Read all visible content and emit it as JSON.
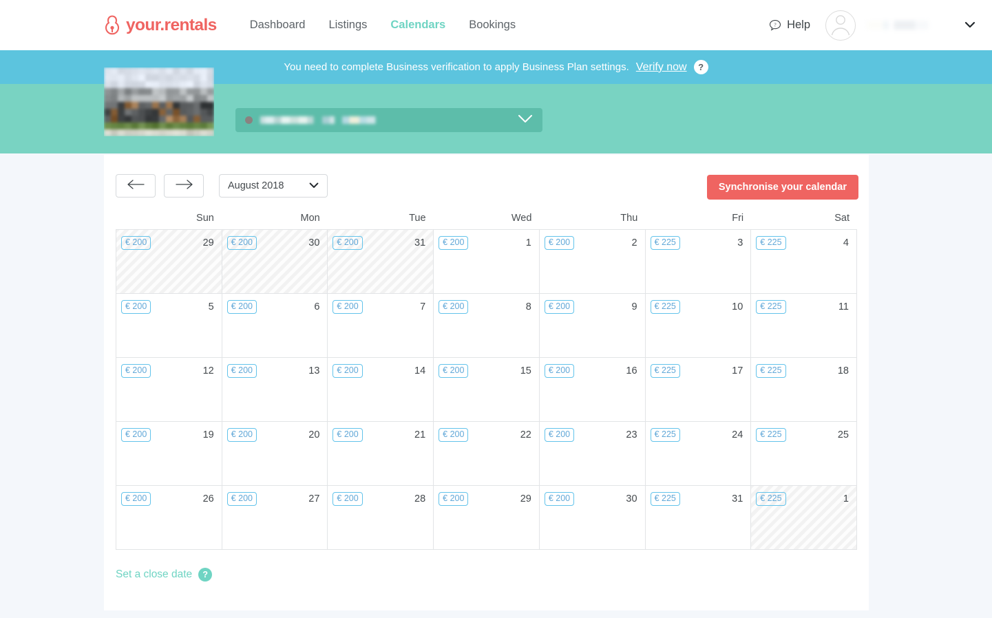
{
  "brand": {
    "name": "your.rentals",
    "logo_icon": "rental-keyhole-icon",
    "color": "#ef6461"
  },
  "nav": {
    "items": [
      {
        "label": "Dashboard",
        "active": false
      },
      {
        "label": "Listings",
        "active": false
      },
      {
        "label": "Calendars",
        "active": true
      },
      {
        "label": "Bookings",
        "active": false
      }
    ],
    "active_color": "#6fd4c3"
  },
  "account": {
    "help_label": "Help",
    "help_icon": "speech-bubble-question-icon",
    "avatar_icon": "user-avatar-icon",
    "user_name": "",
    "caret_icon": "chevron-down-icon"
  },
  "notice": {
    "text": "You need to complete Business verification to apply Business Plan settings.",
    "link_label": "Verify now",
    "help_icon": "question-mark-icon",
    "background": "#5cc4de"
  },
  "property": {
    "thumbnail_alt": "property-photo",
    "selected_name": "",
    "status_dot_color": "#8a8280",
    "chevron_icon": "chevron-down-icon",
    "band_color": "#79d3c2"
  },
  "toolbar": {
    "prev_icon": "arrow-left-icon",
    "next_icon": "arrow-right-icon",
    "month_label": "August 2018",
    "month_chevron_icon": "chevron-down-icon",
    "sync_label": "Synchronise your calendar",
    "sync_color": "#ef6461"
  },
  "calendar": {
    "weekdays": [
      "Sun",
      "Mon",
      "Tue",
      "Wed",
      "Thu",
      "Fri",
      "Sat"
    ],
    "currency": "€",
    "weeks": [
      [
        {
          "day": 29,
          "price": "€ 200",
          "out": true
        },
        {
          "day": 30,
          "price": "€ 200",
          "out": true
        },
        {
          "day": 31,
          "price": "€ 200",
          "out": true
        },
        {
          "day": 1,
          "price": "€ 200",
          "out": false
        },
        {
          "day": 2,
          "price": "€ 200",
          "out": false
        },
        {
          "day": 3,
          "price": "€ 225",
          "out": false
        },
        {
          "day": 4,
          "price": "€ 225",
          "out": false
        }
      ],
      [
        {
          "day": 5,
          "price": "€ 200",
          "out": false
        },
        {
          "day": 6,
          "price": "€ 200",
          "out": false
        },
        {
          "day": 7,
          "price": "€ 200",
          "out": false
        },
        {
          "day": 8,
          "price": "€ 200",
          "out": false
        },
        {
          "day": 9,
          "price": "€ 200",
          "out": false
        },
        {
          "day": 10,
          "price": "€ 225",
          "out": false
        },
        {
          "day": 11,
          "price": "€ 225",
          "out": false
        }
      ],
      [
        {
          "day": 12,
          "price": "€ 200",
          "out": false
        },
        {
          "day": 13,
          "price": "€ 200",
          "out": false
        },
        {
          "day": 14,
          "price": "€ 200",
          "out": false
        },
        {
          "day": 15,
          "price": "€ 200",
          "out": false
        },
        {
          "day": 16,
          "price": "€ 200",
          "out": false
        },
        {
          "day": 17,
          "price": "€ 225",
          "out": false
        },
        {
          "day": 18,
          "price": "€ 225",
          "out": false
        }
      ],
      [
        {
          "day": 19,
          "price": "€ 200",
          "out": false
        },
        {
          "day": 20,
          "price": "€ 200",
          "out": false
        },
        {
          "day": 21,
          "price": "€ 200",
          "out": false
        },
        {
          "day": 22,
          "price": "€ 200",
          "out": false
        },
        {
          "day": 23,
          "price": "€ 200",
          "out": false
        },
        {
          "day": 24,
          "price": "€ 225",
          "out": false
        },
        {
          "day": 25,
          "price": "€ 225",
          "out": false
        }
      ],
      [
        {
          "day": 26,
          "price": "€ 200",
          "out": false
        },
        {
          "day": 27,
          "price": "€ 200",
          "out": false
        },
        {
          "day": 28,
          "price": "€ 200",
          "out": false
        },
        {
          "day": 29,
          "price": "€ 200",
          "out": false
        },
        {
          "day": 30,
          "price": "€ 200",
          "out": false
        },
        {
          "day": 31,
          "price": "€ 225",
          "out": false
        },
        {
          "day": 1,
          "price": "€ 225",
          "out": true
        }
      ]
    ]
  },
  "footer": {
    "close_date_label": "Set a close date",
    "help_icon": "question-mark-icon"
  }
}
